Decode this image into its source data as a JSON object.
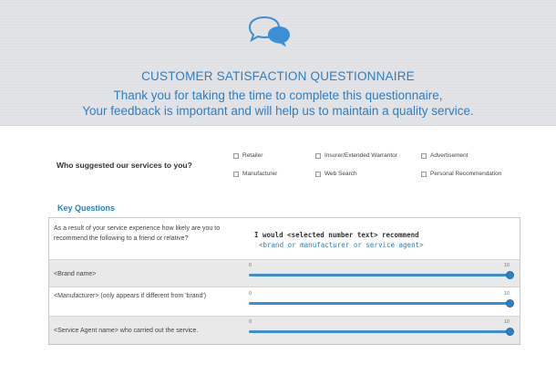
{
  "header": {
    "icon": "speech-bubbles-icon",
    "title": "CUSTOMER SATISFACTION QUESTIONNAIRE",
    "subtitle_line1": "Thank you for taking the time to complete this questionnaire,",
    "subtitle_line2": "Your feedback is important and will help us to maintain a quality service."
  },
  "suggest": {
    "question": "Who suggested our services to you?",
    "options": [
      "Retailer",
      "Insurer/Extended Warrantor",
      "Advertisement",
      "Manufacturer",
      "Web Search",
      "Personal Recommendation"
    ]
  },
  "key_questions": {
    "heading": "Key Questions",
    "header_question": "As a result of your service experience how likely are you to recommend the following to a friend or relative?",
    "header_response_line1": "I would <selected number text> recommend",
    "header_response_line2": "<brand or manufacturer or service agent>",
    "rows": [
      {
        "label": "<Brand name>",
        "min": "0",
        "max": "10",
        "value": 10
      },
      {
        "label": "<Manufacturer> (only appears if different from 'brand')",
        "min": "0",
        "max": "10",
        "value": 10
      },
      {
        "label": "<Service Agent name> who carried out the service.",
        "min": "0",
        "max": "10",
        "value": 10
      }
    ]
  },
  "colors": {
    "accent": "#2f7ec1",
    "header_bg": "#dfe1e4",
    "slider_fill": "#3d8fd4"
  }
}
